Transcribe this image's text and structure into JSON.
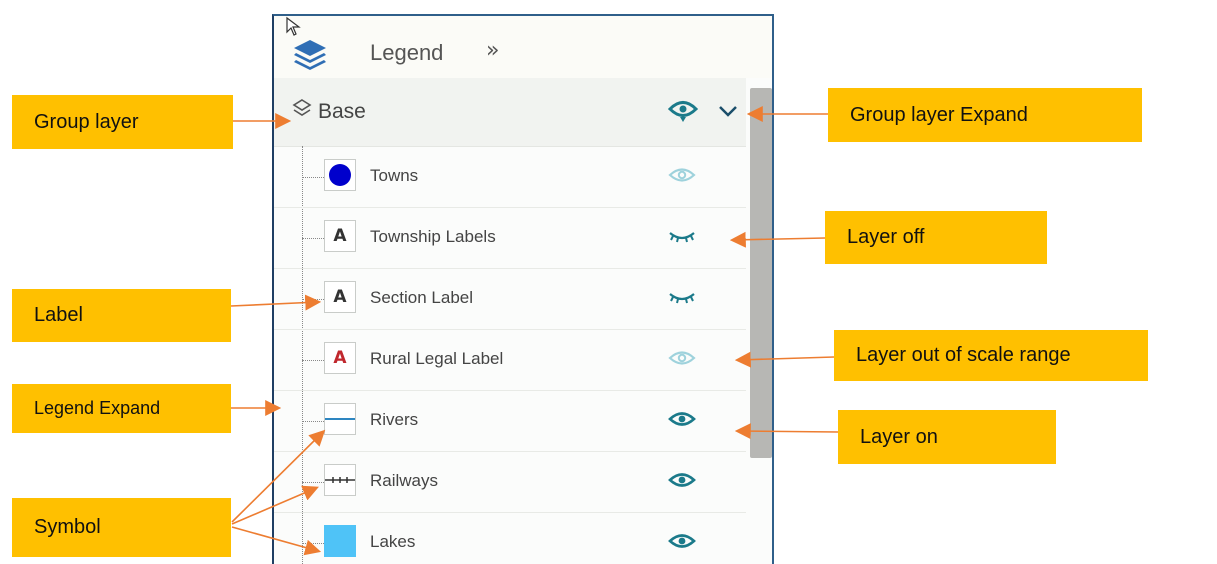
{
  "panel": {
    "header": {
      "title": "Legend",
      "expand_glyph": "»"
    },
    "group": {
      "label": "Base"
    },
    "layers": [
      {
        "label": "Towns",
        "symbol": "circle",
        "visibility": "out-of-scale"
      },
      {
        "label": "Township Labels",
        "symbol": "A",
        "visibility": "off"
      },
      {
        "label": "Section Label",
        "symbol": "A",
        "visibility": "off"
      },
      {
        "label": "Rural Legal Label",
        "symbol": "A-red",
        "visibility": "out-of-scale"
      },
      {
        "label": "Rivers",
        "symbol": "line",
        "visibility": "on"
      },
      {
        "label": "Railways",
        "symbol": "railway",
        "visibility": "on"
      },
      {
        "label": "Lakes",
        "symbol": "square",
        "visibility": "on"
      }
    ]
  },
  "callouts": {
    "group_layer": "Group layer",
    "label": "Label",
    "legend_expand": "Legend Expand",
    "symbol": "Symbol",
    "group_layer_expand": "Group layer Expand",
    "layer_off": "Layer off",
    "layer_out_of_scale": "Layer out of scale range",
    "layer_on": "Layer on"
  },
  "colors": {
    "callout_fill": "#FFC000",
    "arrow": "#ED7D31",
    "eye_on": "#1B7A8A",
    "eye_out_of_scale": "#9ED2DC",
    "town_symbol": "#0000CC",
    "lake_symbol": "#4FC3F7",
    "river_symbol": "#2E86C1",
    "label_red": "#C0272D",
    "panel_border": "#2F5F8A",
    "side_tab": "#2F6EB5"
  }
}
